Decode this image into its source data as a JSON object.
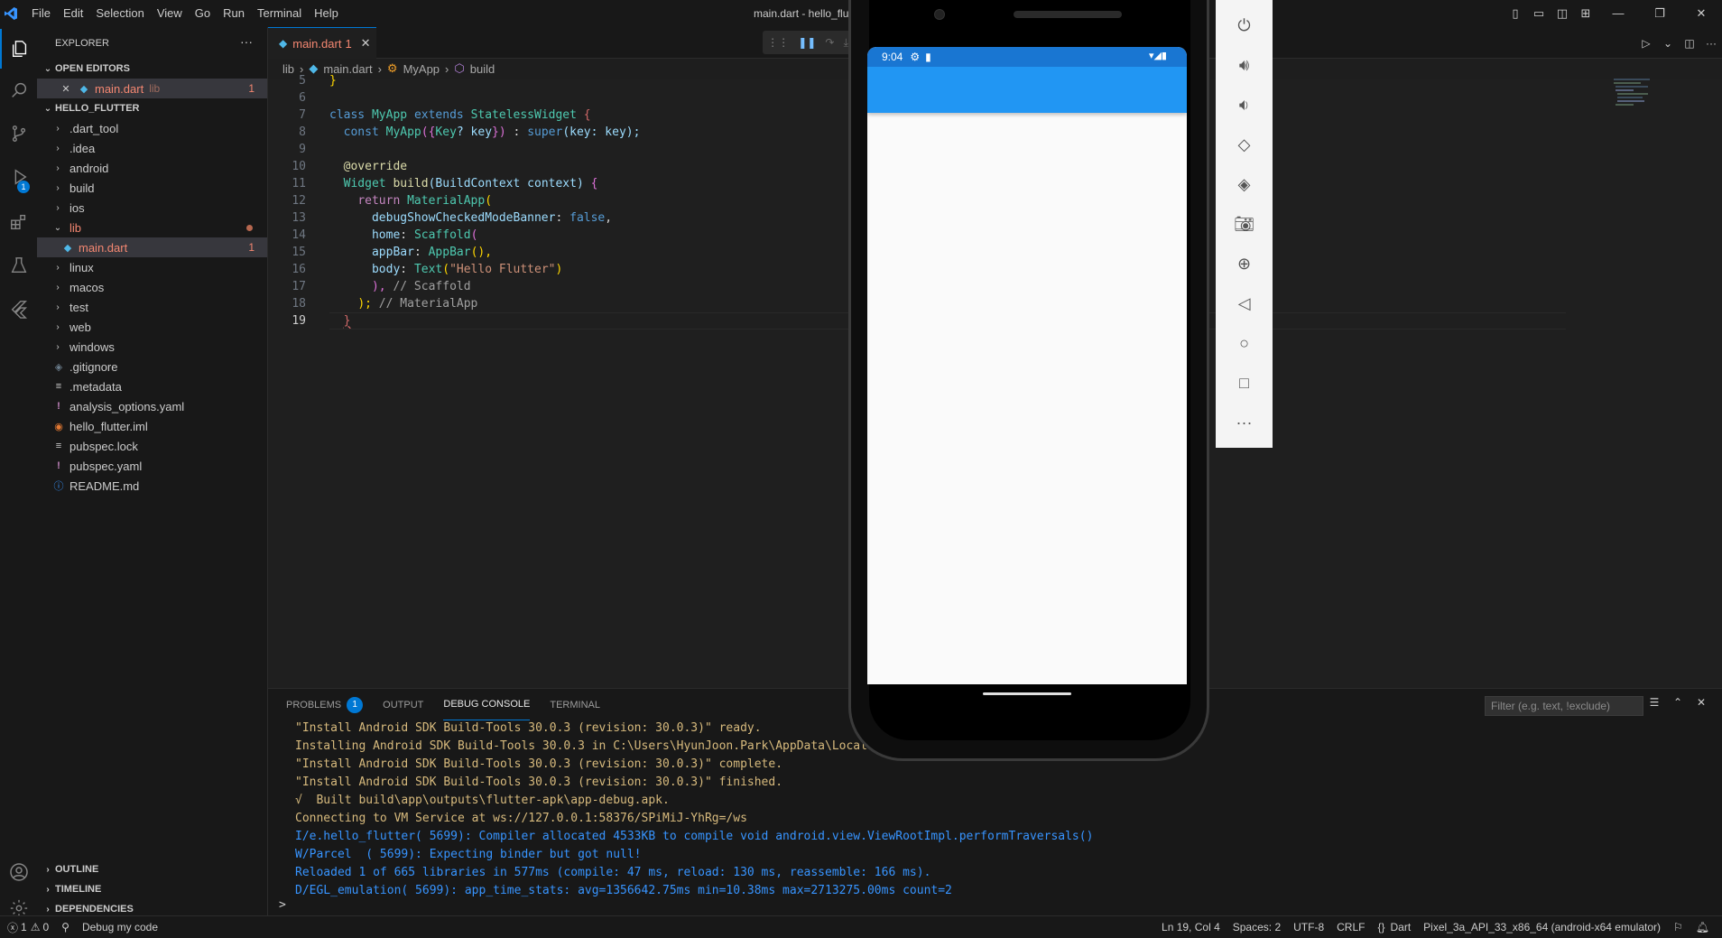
{
  "titlebar": {
    "menu": [
      "File",
      "Edit",
      "Selection",
      "View",
      "Go",
      "Run",
      "Terminal",
      "Help"
    ],
    "title": "main.dart - hello_flu"
  },
  "activity": {
    "debug_badge": "1"
  },
  "sidebar": {
    "header": "EXPLORER",
    "open_editors_label": "OPEN EDITORS",
    "open_editor": {
      "name": "main.dart",
      "folder": "lib",
      "count": "1"
    },
    "project_label": "HELLO_FLUTTER",
    "tree": [
      {
        "name": ".dart_tool"
      },
      {
        "name": ".idea"
      },
      {
        "name": "android"
      },
      {
        "name": "build"
      },
      {
        "name": "ios"
      },
      {
        "name": "lib"
      },
      {
        "name": "main.dart",
        "count": "1"
      },
      {
        "name": "linux"
      },
      {
        "name": "macos"
      },
      {
        "name": "test"
      },
      {
        "name": "web"
      },
      {
        "name": "windows"
      },
      {
        "name": ".gitignore"
      },
      {
        "name": ".metadata"
      },
      {
        "name": "analysis_options.yaml"
      },
      {
        "name": "hello_flutter.iml"
      },
      {
        "name": "pubspec.lock"
      },
      {
        "name": "pubspec.yaml"
      },
      {
        "name": "README.md"
      }
    ],
    "outline": "OUTLINE",
    "timeline": "TIMELINE",
    "dependencies": "DEPENDENCIES"
  },
  "tab": {
    "label": "main.dart",
    "count": "1"
  },
  "breadcrumb": [
    "lib",
    "main.dart",
    "MyApp",
    "build"
  ],
  "editor": {
    "line_numbers": [
      "5",
      "6",
      "7",
      "8",
      "9",
      "10",
      "11",
      "12",
      "13",
      "14",
      "15",
      "16",
      "17",
      "18",
      "19"
    ],
    "lines": {
      "l5": "}",
      "l7a": "class",
      "l7b": "MyApp",
      "l7c": "extends",
      "l7d": "StatelessWidget",
      "l7e": "{",
      "l8a": "const",
      "l8b": "MyApp",
      "l8c": "({",
      "l8d": "Key",
      "l8e": "? key",
      "l8f": "})",
      "l8g": " : ",
      "l8h": "super",
      "l8i": "(key: key);",
      "l10": "@override",
      "l11a": "Widget",
      "l11b": "build",
      "l11c": "(BuildContext context)",
      "l11d": " {",
      "l12a": "return",
      "l12b": "MaterialApp",
      "l12c": "(",
      "l13a": "debugShowCheckedModeBanner",
      "l13b": ": ",
      "l13c": "false",
      "l13d": ",",
      "l14a": "home",
      "l14b": ": ",
      "l14c": "Scaffold",
      "l14d": "(",
      "l15a": "appBar",
      "l15b": ": ",
      "l15c": "AppBar",
      "l15d": "(),",
      "l16a": "body",
      "l16b": ": ",
      "l16c": "Text",
      "l16d": "(",
      "l16e": "\"Hello Flutter\"",
      "l16f": ")",
      "l17a": "), ",
      "l17b": "// Scaffold",
      "l18a": "); ",
      "l18b": "// MaterialApp",
      "l19": "}"
    }
  },
  "phone": {
    "time": "9:04"
  },
  "panel": {
    "tabs": [
      "PROBLEMS",
      "OUTPUT",
      "DEBUG CONSOLE",
      "TERMINAL"
    ],
    "problems_count": "1",
    "filter_placeholder": "Filter (e.g. text, !exclude)",
    "console": [
      "\"Install Android SDK Build-Tools 30.0.3 (revision: 30.0.3)\" ready.",
      "Installing Android SDK Build-Tools 30.0.3 in C:\\Users\\HyunJoon.Park\\AppData\\Local\\",
      "\"Install Android SDK Build-Tools 30.0.3 (revision: 30.0.3)\" complete.",
      "\"Install Android SDK Build-Tools 30.0.3 (revision: 30.0.3)\" finished.",
      "√  Built build\\app\\outputs\\flutter-apk\\app-debug.apk.",
      "Connecting to VM Service at ws://127.0.0.1:58376/SPiMiJ-YhRg=/ws",
      "I/e.hello_flutter( 5699): Compiler allocated 4533KB to compile void android.view.ViewRootImpl.performTraversals()",
      "W/Parcel  ( 5699): Expecting binder but got null!",
      "Reloaded 1 of 665 libraries in 577ms (compile: 47 ms, reload: 130 ms, reassemble: 166 ms).",
      "D/EGL_emulation( 5699): app_time_stats: avg=1356642.75ms min=10.38ms max=2713275.00ms count=2"
    ],
    "prompt": ">"
  },
  "status": {
    "errors": "1",
    "warnings": "0",
    "debug": "Debug my code",
    "position": "Ln 19, Col 4",
    "spaces": "Spaces: 2",
    "encoding": "UTF-8",
    "eol": "CRLF",
    "language": "Dart",
    "device": "Pixel_3a_API_33_x86_64 (android-x64 emulator)"
  }
}
